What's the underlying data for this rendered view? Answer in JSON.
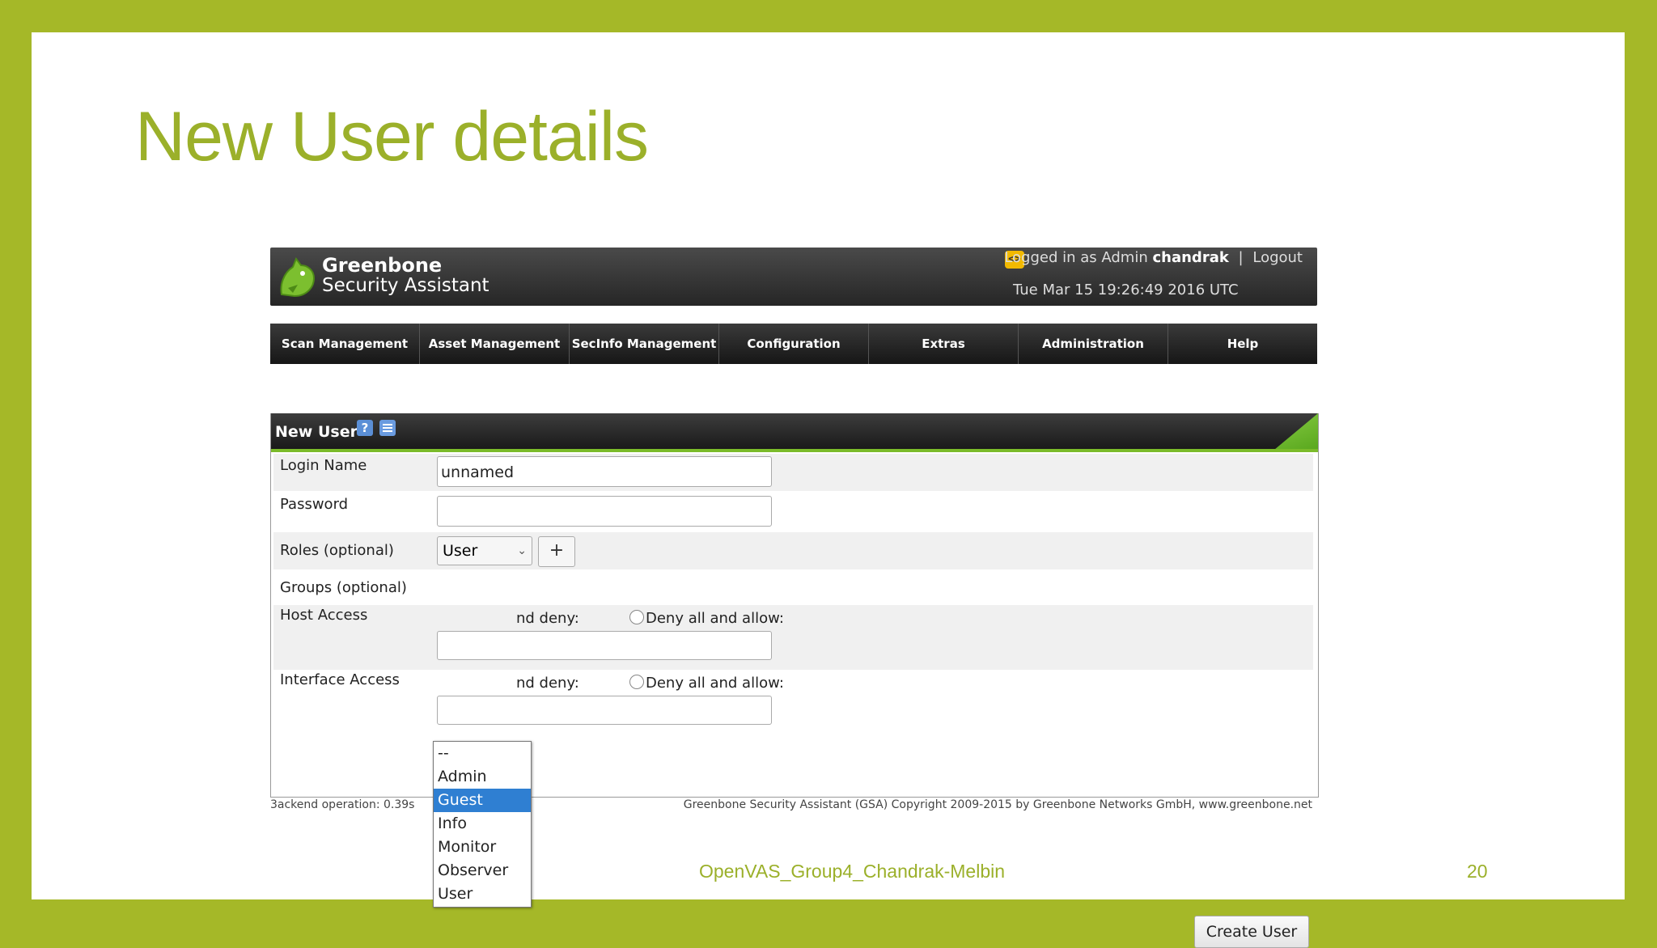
{
  "slide": {
    "title": "New User details",
    "footer": "OpenVAS_Group4_Chandrak-Melbin",
    "page_number": "20",
    "accent_color": "#a5b828"
  },
  "header": {
    "brand_line1": "Greenbone",
    "brand_line2": "Security Assistant",
    "logged_in_prefix": "Logged in as Admin",
    "username": "chandrak",
    "separator": "|",
    "logout": "Logout",
    "datetime": "Tue Mar 15 19:26:49 2016 UTC"
  },
  "nav": {
    "items": [
      "Scan Management",
      "Asset Management",
      "SecInfo Management",
      "Configuration",
      "Extras",
      "Administration",
      "Help"
    ]
  },
  "panel": {
    "title": "New User",
    "help_icon": "?",
    "fields": {
      "login_name": {
        "label": "Login Name",
        "value": "unnamed"
      },
      "password": {
        "label": "Password",
        "value": ""
      },
      "roles": {
        "label": "Roles (optional)",
        "selected": "User",
        "add_label": "+"
      },
      "groups": {
        "label": "Groups (optional)"
      },
      "host_access": {
        "label": "Host Access",
        "allow_partial": "nd deny:",
        "deny_all": "Deny all and allow:"
      },
      "interface_access": {
        "label": "Interface Access",
        "allow_partial": "nd deny:",
        "deny_all": "Deny all and allow:"
      }
    },
    "roles_dropdown": {
      "options": [
        "--",
        "Admin",
        "Guest",
        "Info",
        "Monitor",
        "Observer",
        "User"
      ],
      "highlighted": "Guest"
    },
    "create_button": "Create User"
  },
  "status": {
    "backend": "3ackend operation: 0.39s",
    "copyright": "Greenbone Security Assistant (GSA) Copyright 2009-2015 by Greenbone Networks GmbH, www.greenbone.net"
  }
}
